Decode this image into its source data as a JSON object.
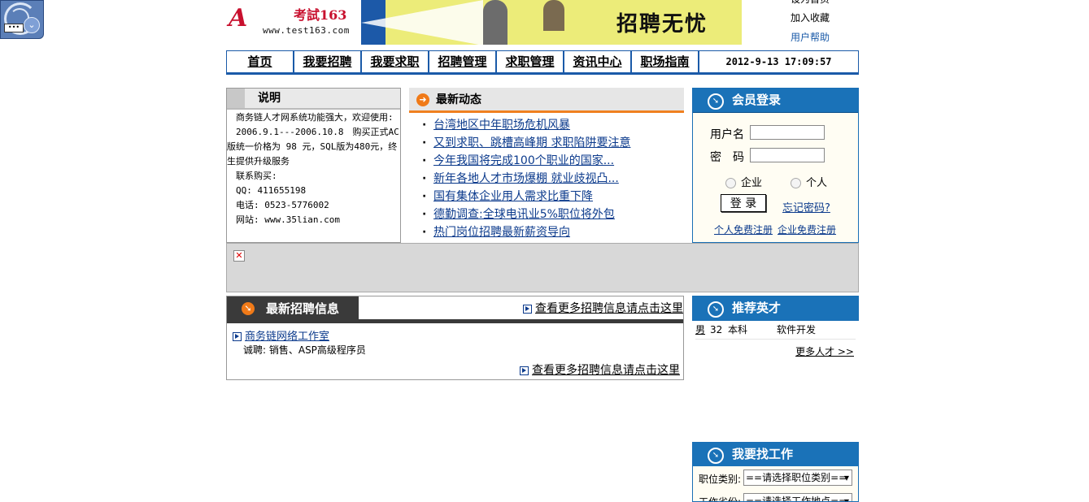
{
  "header": {
    "logo_mark": "A",
    "logo_name": "考試163",
    "logo_url": "www.test163.com",
    "banner_text": "招聘无忧",
    "links": [
      "设为首页",
      "加入收藏",
      "用户帮助"
    ]
  },
  "nav": {
    "items": [
      "首页",
      "我要招聘",
      "我要求职",
      "招聘管理",
      "求职管理",
      "资讯中心",
      "职场指南"
    ],
    "clock": "2012-9-13 17:09:57"
  },
  "explain": {
    "title": "说明",
    "lines": [
      "　商务链人才网系统功能强大，欢迎使用:",
      "　2006.9.1---2006.10.8　购买正式AC版统一价格为 98 元，SQL版为480元，终生提供升级服务",
      "　联系购买:",
      "　QQ: 411655198",
      "　电话: 0523-5776002",
      "　网站: www.35lian.com"
    ]
  },
  "news": {
    "title": "最新动态",
    "items": [
      "台湾地区中年职场危机风暴",
      "又到求职、跳槽高峰期 求职陷阱要注意",
      "今年我国将完成100个职业的国家...",
      "新年各地人才市场爆棚 就业歧视凸...",
      "国有集体企业用人需求比重下降",
      "德勤调查:全球电讯业5%职位将外包",
      "热门岗位招聘最新薪资导向"
    ]
  },
  "login": {
    "title": "会员登录",
    "username_label": "用户名",
    "password_label": "密　码",
    "radio_company": "企业",
    "radio_person": "个人",
    "login_button": "登 录",
    "forgot": "忘记密码?",
    "register_person": "个人免费注册",
    "register_company": "企业免费注册"
  },
  "jobs": {
    "title": "最新招聘信息",
    "more": "查看更多招聘信息请点击这里",
    "company": "商务链网络工作室",
    "hiring": "诚聘: 销售、ASP高级程序员",
    "more_bottom": "查看更多招聘信息请点击这里"
  },
  "talent": {
    "title": "推荐英才",
    "rows": [
      {
        "gender": "男",
        "age": "32",
        "education": "本科",
        "major": "软件开发"
      }
    ],
    "more": "更多人才 >>"
  },
  "findjob": {
    "title": "我要找工作",
    "category_label": "职位类别:",
    "category_value": "==请选择职位类别==",
    "location_label": "工作省份:",
    "location_value": "==请选择工作地点=="
  },
  "colors": {
    "nav_blue": "#1a5aa8",
    "box_blue": "#1a72b8",
    "accent_orange": "#f07a18",
    "link_blue": "#0b3a8c"
  }
}
